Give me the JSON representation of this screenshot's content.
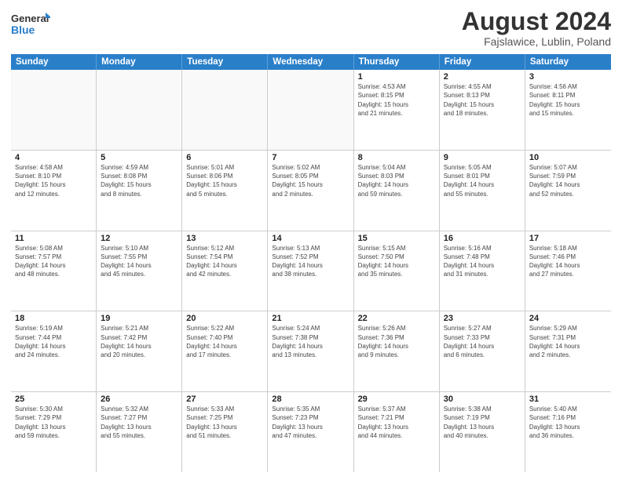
{
  "header": {
    "logo_line1": "General",
    "logo_line2": "Blue",
    "month_title": "August 2024",
    "location": "Fajslawice, Lublin, Poland"
  },
  "weekdays": [
    "Sunday",
    "Monday",
    "Tuesday",
    "Wednesday",
    "Thursday",
    "Friday",
    "Saturday"
  ],
  "rows": [
    [
      {
        "day": "",
        "info": "",
        "empty": true
      },
      {
        "day": "",
        "info": "",
        "empty": true
      },
      {
        "day": "",
        "info": "",
        "empty": true
      },
      {
        "day": "",
        "info": "",
        "empty": true
      },
      {
        "day": "1",
        "info": "Sunrise: 4:53 AM\nSunset: 8:15 PM\nDaylight: 15 hours\nand 21 minutes."
      },
      {
        "day": "2",
        "info": "Sunrise: 4:55 AM\nSunset: 8:13 PM\nDaylight: 15 hours\nand 18 minutes."
      },
      {
        "day": "3",
        "info": "Sunrise: 4:56 AM\nSunset: 8:11 PM\nDaylight: 15 hours\nand 15 minutes."
      }
    ],
    [
      {
        "day": "4",
        "info": "Sunrise: 4:58 AM\nSunset: 8:10 PM\nDaylight: 15 hours\nand 12 minutes."
      },
      {
        "day": "5",
        "info": "Sunrise: 4:59 AM\nSunset: 8:08 PM\nDaylight: 15 hours\nand 8 minutes."
      },
      {
        "day": "6",
        "info": "Sunrise: 5:01 AM\nSunset: 8:06 PM\nDaylight: 15 hours\nand 5 minutes."
      },
      {
        "day": "7",
        "info": "Sunrise: 5:02 AM\nSunset: 8:05 PM\nDaylight: 15 hours\nand 2 minutes."
      },
      {
        "day": "8",
        "info": "Sunrise: 5:04 AM\nSunset: 8:03 PM\nDaylight: 14 hours\nand 59 minutes."
      },
      {
        "day": "9",
        "info": "Sunrise: 5:05 AM\nSunset: 8:01 PM\nDaylight: 14 hours\nand 55 minutes."
      },
      {
        "day": "10",
        "info": "Sunrise: 5:07 AM\nSunset: 7:59 PM\nDaylight: 14 hours\nand 52 minutes."
      }
    ],
    [
      {
        "day": "11",
        "info": "Sunrise: 5:08 AM\nSunset: 7:57 PM\nDaylight: 14 hours\nand 48 minutes."
      },
      {
        "day": "12",
        "info": "Sunrise: 5:10 AM\nSunset: 7:55 PM\nDaylight: 14 hours\nand 45 minutes."
      },
      {
        "day": "13",
        "info": "Sunrise: 5:12 AM\nSunset: 7:54 PM\nDaylight: 14 hours\nand 42 minutes."
      },
      {
        "day": "14",
        "info": "Sunrise: 5:13 AM\nSunset: 7:52 PM\nDaylight: 14 hours\nand 38 minutes."
      },
      {
        "day": "15",
        "info": "Sunrise: 5:15 AM\nSunset: 7:50 PM\nDaylight: 14 hours\nand 35 minutes."
      },
      {
        "day": "16",
        "info": "Sunrise: 5:16 AM\nSunset: 7:48 PM\nDaylight: 14 hours\nand 31 minutes."
      },
      {
        "day": "17",
        "info": "Sunrise: 5:18 AM\nSunset: 7:46 PM\nDaylight: 14 hours\nand 27 minutes."
      }
    ],
    [
      {
        "day": "18",
        "info": "Sunrise: 5:19 AM\nSunset: 7:44 PM\nDaylight: 14 hours\nand 24 minutes."
      },
      {
        "day": "19",
        "info": "Sunrise: 5:21 AM\nSunset: 7:42 PM\nDaylight: 14 hours\nand 20 minutes."
      },
      {
        "day": "20",
        "info": "Sunrise: 5:22 AM\nSunset: 7:40 PM\nDaylight: 14 hours\nand 17 minutes."
      },
      {
        "day": "21",
        "info": "Sunrise: 5:24 AM\nSunset: 7:38 PM\nDaylight: 14 hours\nand 13 minutes."
      },
      {
        "day": "22",
        "info": "Sunrise: 5:26 AM\nSunset: 7:36 PM\nDaylight: 14 hours\nand 9 minutes."
      },
      {
        "day": "23",
        "info": "Sunrise: 5:27 AM\nSunset: 7:33 PM\nDaylight: 14 hours\nand 6 minutes."
      },
      {
        "day": "24",
        "info": "Sunrise: 5:29 AM\nSunset: 7:31 PM\nDaylight: 14 hours\nand 2 minutes."
      }
    ],
    [
      {
        "day": "25",
        "info": "Sunrise: 5:30 AM\nSunset: 7:29 PM\nDaylight: 13 hours\nand 59 minutes."
      },
      {
        "day": "26",
        "info": "Sunrise: 5:32 AM\nSunset: 7:27 PM\nDaylight: 13 hours\nand 55 minutes."
      },
      {
        "day": "27",
        "info": "Sunrise: 5:33 AM\nSunset: 7:25 PM\nDaylight: 13 hours\nand 51 minutes."
      },
      {
        "day": "28",
        "info": "Sunrise: 5:35 AM\nSunset: 7:23 PM\nDaylight: 13 hours\nand 47 minutes."
      },
      {
        "day": "29",
        "info": "Sunrise: 5:37 AM\nSunset: 7:21 PM\nDaylight: 13 hours\nand 44 minutes."
      },
      {
        "day": "30",
        "info": "Sunrise: 5:38 AM\nSunset: 7:19 PM\nDaylight: 13 hours\nand 40 minutes."
      },
      {
        "day": "31",
        "info": "Sunrise: 5:40 AM\nSunset: 7:16 PM\nDaylight: 13 hours\nand 36 minutes."
      }
    ]
  ]
}
